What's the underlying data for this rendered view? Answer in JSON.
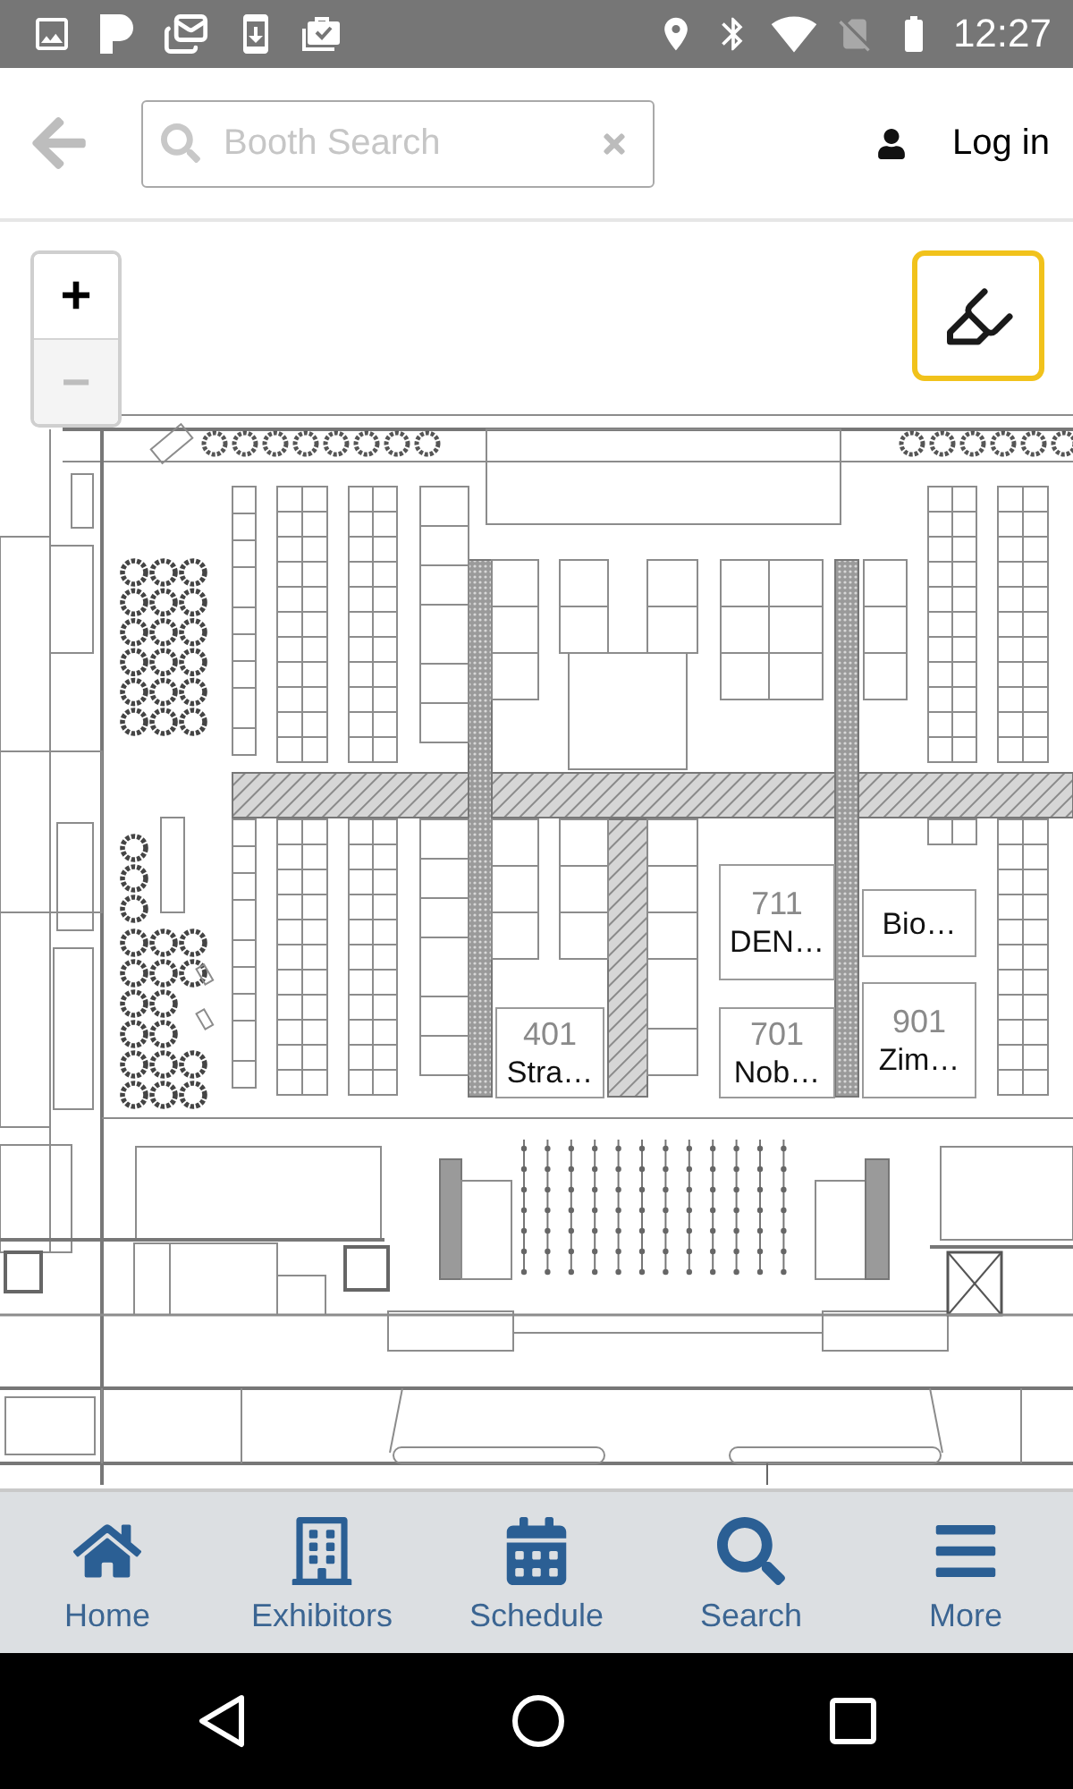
{
  "status_bar": {
    "time": "12:27"
  },
  "header": {
    "search": {
      "placeholder": "Booth Search"
    },
    "login": "Log in"
  },
  "map": {
    "zoom_in": {
      "label": "+",
      "disabled": false
    },
    "zoom_out": {
      "label": "−",
      "disabled": true
    },
    "booths": [
      {
        "number": "711",
        "name": "DEN…"
      },
      {
        "name": "Bio…"
      },
      {
        "number": "401",
        "name": "Stra…"
      },
      {
        "number": "701",
        "name": "Nob…"
      },
      {
        "number": "901",
        "name": "Zim…"
      }
    ]
  },
  "bottom_nav": [
    {
      "label": "Home",
      "selected": false
    },
    {
      "label": "Exhibitors",
      "selected": false
    },
    {
      "label": "Schedule",
      "selected": false
    },
    {
      "label": "Search",
      "selected": false
    },
    {
      "label": "More",
      "selected": false
    }
  ]
}
